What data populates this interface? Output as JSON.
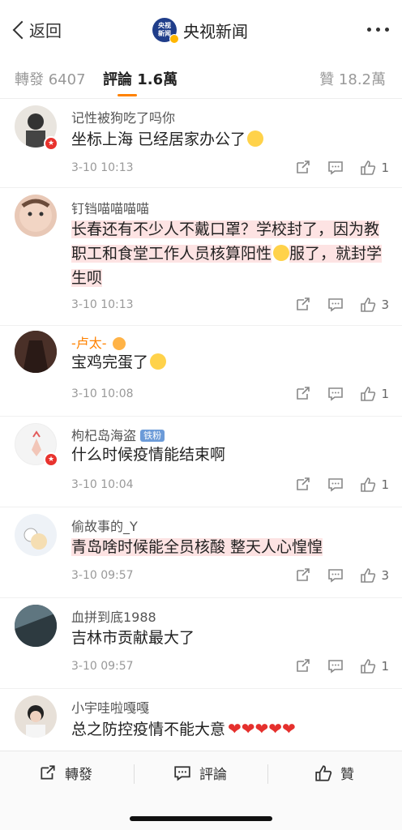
{
  "nav": {
    "back_label": "返回",
    "logo_text": "央视新闻",
    "title": "央视新闻",
    "more_icon": "more-dots-icon"
  },
  "tabs": {
    "repost": "轉發 6407",
    "comment": "評論 1.6萬",
    "like": "贊 18.2萬",
    "accent": "#ff8200"
  },
  "comments": [
    {
      "user": "记性被狗吃了吗你",
      "text": "坐标上海 已经居家办公了",
      "emoji": "😂",
      "time": "3-10 10:13",
      "likes": "1"
    },
    {
      "user": "钉铛喵喵喵喵",
      "text1": "长春还有不少人不戴口罩？学校封了，因为教职工和食堂工作人员核算阳性",
      "emoji": "🙂",
      "text2": "服了，就封学生呗",
      "time": "3-10 10:13",
      "likes": "3"
    },
    {
      "user": "-卢太-",
      "text": "宝鸡完蛋了",
      "emoji": "😱",
      "time": "3-10 10:08",
      "likes": "1"
    },
    {
      "user": "枸杞岛海盗",
      "badge": "铁粉",
      "text": "什么时候疫情能结束啊",
      "time": "3-10 10:04",
      "likes": "1"
    },
    {
      "user": "偷故事的_Y",
      "text": "青岛啥时候能全员核酸 整天人心惶惶",
      "time": "3-10 09:57",
      "likes": "3"
    },
    {
      "user": "血拼到底1988",
      "text": "吉林市贡献最大了",
      "time": "3-10 09:57",
      "likes": "1"
    },
    {
      "user": "小宇哇啦嘎嘎",
      "text": "总之防控疫情不能大意",
      "hearts": "❤❤❤❤❤"
    }
  ],
  "bottom": {
    "repost": "轉發",
    "comment": "評論",
    "like": "贊"
  }
}
